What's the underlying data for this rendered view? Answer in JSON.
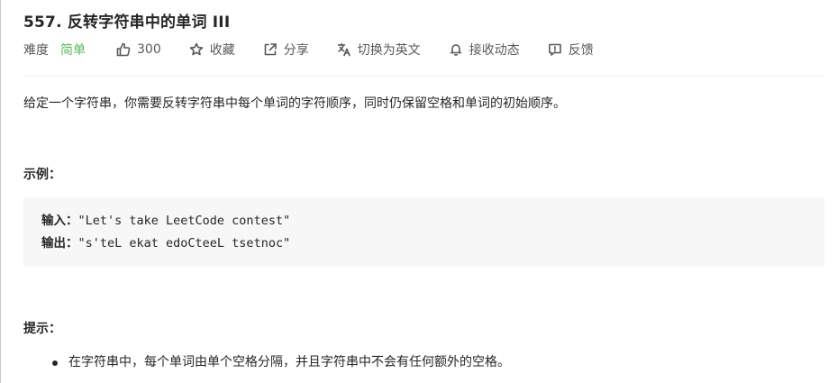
{
  "problem": {
    "title": "557. 反转字符串中的单词 III",
    "difficulty_label": "难度",
    "difficulty_value": "简单",
    "difficulty_color": "#5cb85c",
    "likes": "300",
    "collect_label": "收藏",
    "share_label": "分享",
    "switch_lang_label": "切换为英文",
    "subscribe_label": "接收动态",
    "feedback_label": "反馈",
    "description": "给定一个字符串，你需要反转字符串中每个单词的字符顺序，同时仍保留空格和单词的初始顺序。"
  },
  "example": {
    "section_title": "示例：",
    "input_label": "输入：",
    "input_value": "\"Let's take LeetCode contest\"",
    "output_label": "输出：",
    "output_value": "\"s'teL ekat edoCteeL tsetnoc\""
  },
  "hints": {
    "section_title": "提示：",
    "items": [
      "在字符串中，每个单词由单个空格分隔，并且字符串中不会有任何额外的空格。"
    ]
  },
  "icons": {
    "like": "thumbs-up-icon",
    "collect": "star-icon",
    "share": "share-icon",
    "translate": "translate-icon",
    "subscribe": "bell-icon",
    "feedback": "feedback-icon"
  }
}
